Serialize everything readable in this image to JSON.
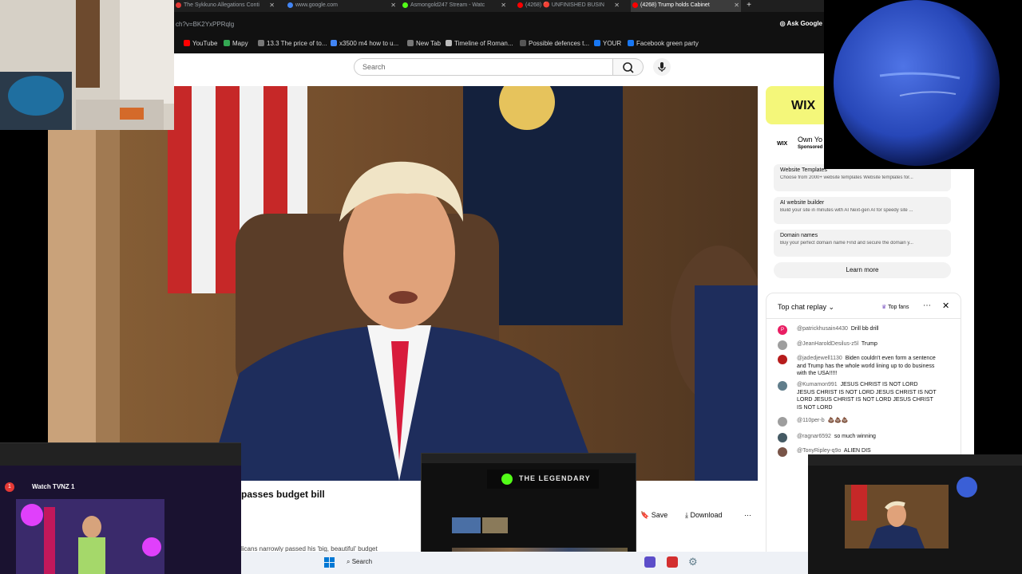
{
  "browser": {
    "tabs": [
      {
        "label": "The Sykkuno Allegations Conti",
        "color": "#e53935",
        "active": false
      },
      {
        "label": "www.google.com",
        "color": "#4285f4",
        "active": false
      },
      {
        "label": "Asmongold247 Stream - Watc",
        "color": "#53fc18",
        "active": false
      },
      {
        "label": "(4268) 🔴 UNFINISHED BUSIN",
        "color": "#ff0000",
        "active": false
      },
      {
        "label": "(4268) Trump holds Cabinet",
        "color": "#ff0000",
        "active": true
      }
    ],
    "url": "ch?v=BK2YxPPRqlg",
    "ask_google": "Ask Google",
    "bookmarks": [
      {
        "label": "YouTube",
        "color": "#ff0000"
      },
      {
        "label": "Mapy",
        "color": "#34a853"
      },
      {
        "label": "13.3 The price of to...",
        "color": "#777777"
      },
      {
        "label": "x3500 m4 how to u...",
        "color": "#4285f4"
      },
      {
        "label": "New Tab",
        "color": "#777777"
      },
      {
        "label": "Timeline of Roman...",
        "color": "#bbbbbb"
      },
      {
        "label": "Possible defences t...",
        "color": "#555555"
      },
      {
        "label": "YOUR",
        "color": "#1877f2"
      },
      {
        "label": "Facebook green party",
        "color": "#1877f2"
      }
    ]
  },
  "youtube": {
    "search_placeholder": "Search",
    "video_title": "passes budget bill",
    "description_snippet": "licans narrowly passed his 'big, beautiful' budget",
    "actions": {
      "save": "Save",
      "download": "Download",
      "more": "⋯"
    },
    "ad": {
      "brand": "WIX",
      "headline": "Own Yo",
      "sponsored": "Sponsored",
      "items": [
        {
          "title": "Website Templates",
          "desc": "Choose from 2000+ website templates Website templates for..."
        },
        {
          "title": "AI website builder",
          "desc": "Build your site in minutes with AI Next-gen AI for speedy site ..."
        },
        {
          "title": "Domain names",
          "desc": "Buy your perfect domain name Find and secure the domain y..."
        }
      ],
      "learn_more": "Learn more"
    },
    "chat": {
      "header": "Top chat replay",
      "top_fans": "Top fans",
      "messages": [
        {
          "author": "@patrickhusain4430",
          "text": "Drill bb drill",
          "avatar": "P",
          "color": "#e91e63"
        },
        {
          "author": "@JeanHaroldDesilus-z5l",
          "text": "Trump",
          "avatar": "",
          "color": "#9e9e9e"
        },
        {
          "author": "@jadedjewell1130",
          "text": "Biden couldn't even form a sentence and Trump has the whole world lining up to do business with the USA!!!!!",
          "avatar": "",
          "color": "#b71c1c"
        },
        {
          "author": "@Kumamon991",
          "text": "JESUS CHRIST IS NOT LORD JESUS CHRIST IS NOT LORD JESUS CHRIST IS NOT LORD JESUS CHRIST IS NOT LORD JESUS CHRIST IS NOT LORD",
          "avatar": "",
          "color": "#607d8b"
        },
        {
          "author": "@110per-b",
          "text": "💩💩💩",
          "avatar": "",
          "color": "#9e9e9e"
        },
        {
          "author": "@ragnar6592",
          "text": "so much winning",
          "avatar": "",
          "color": "#455a64"
        },
        {
          "author": "@TonyRipley-q9o",
          "text": "ALIEN DIS",
          "avatar": "",
          "color": "#795548"
        }
      ]
    }
  },
  "overlays": {
    "tvnz_title": "Watch TVNZ 1",
    "kick_banner": "THE LEGENDARY",
    "taskbar_search": "Search"
  }
}
